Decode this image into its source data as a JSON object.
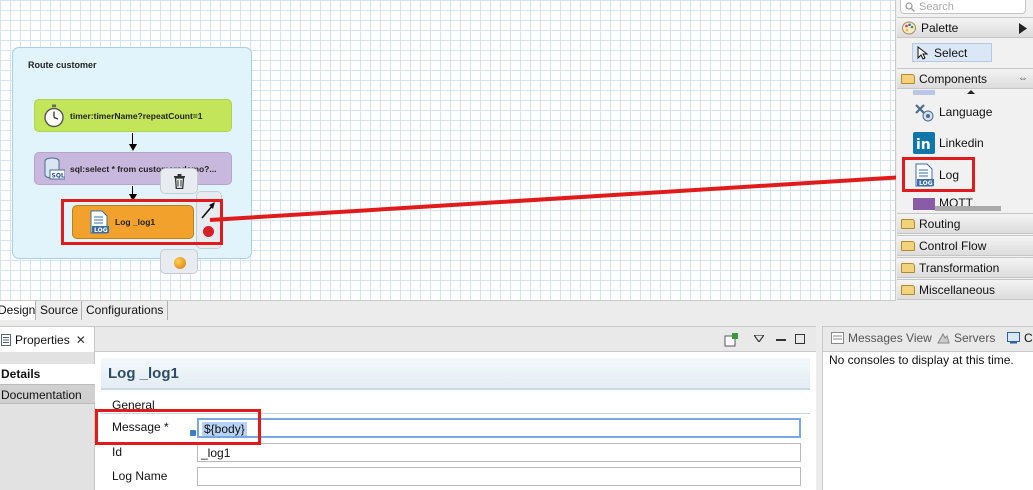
{
  "route": {
    "title": "Route customer",
    "nodes": {
      "timer": "timer:timerName?repeatCount=1",
      "sql": "sql:select * from customersdemo?...",
      "log": "Log _log1"
    }
  },
  "palette": {
    "search_placeholder": "Search",
    "title": "Palette",
    "select": "Select",
    "components": "Components",
    "items": [
      "Language",
      "Linkedin",
      "Log",
      "MQTT"
    ],
    "drawers": [
      "Routing",
      "Control Flow",
      "Transformation",
      "Miscellaneous"
    ]
  },
  "editor_tabs": [
    "Design",
    "Source",
    "Configurations"
  ],
  "properties": {
    "tab_label": "Properties",
    "side_tabs": [
      "Details",
      "Documentation"
    ],
    "title": "Log _log1",
    "section": "General",
    "fields": {
      "message_label": "Message *",
      "message_value": "${body}",
      "id_label": "Id",
      "id_value": "_log1",
      "logname_label": "Log Name",
      "logname_value": ""
    }
  },
  "console": {
    "tabs": [
      "Messages View",
      "Servers",
      "C"
    ],
    "empty_text": "No consoles to display at this time."
  },
  "colors": {
    "highlight_red": "#e11b1b",
    "log_node": "#f2a12d",
    "timer_node": "#c2e55a",
    "sql_node": "#c9b8de",
    "route_bg": "#e1f3fb"
  }
}
